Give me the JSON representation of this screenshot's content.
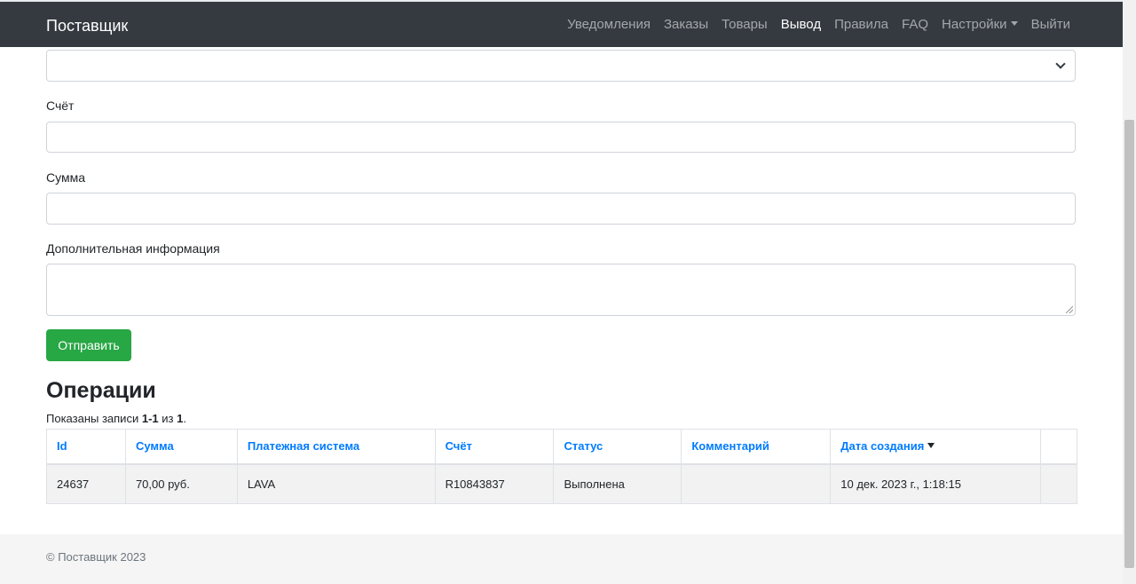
{
  "navbar": {
    "brand": "Поставщик",
    "links": [
      {
        "label": "Уведомления",
        "active": false
      },
      {
        "label": "Заказы",
        "active": false
      },
      {
        "label": "Товары",
        "active": false
      },
      {
        "label": "Вывод",
        "active": true
      },
      {
        "label": "Правила",
        "active": false
      },
      {
        "label": "FAQ",
        "active": false
      },
      {
        "label": "Настройки",
        "active": false,
        "dropdown": true
      },
      {
        "label": "Выйти",
        "active": false
      }
    ]
  },
  "form": {
    "payment_system_value": "",
    "account_label": "Счёт",
    "account_value": "",
    "sum_label": "Сумма",
    "sum_value": "",
    "info_label": "Дополнительная информация",
    "info_value": "",
    "submit_label": "Отправить"
  },
  "operations": {
    "title": "Операции",
    "summary_prefix": "Показаны записи",
    "summary_range": "1-1",
    "summary_of": "из",
    "summary_total": "1",
    "summary_end": ".",
    "columns": [
      "Id",
      "Сумма",
      "Платежная система",
      "Счёт",
      "Статус",
      "Комментарий",
      "Дата создания",
      ""
    ],
    "rows": [
      [
        "24637",
        "70,00 руб.",
        "LAVA",
        "R10843837",
        "Выполнена",
        "",
        "10 дек. 2023 г., 1:18:15",
        ""
      ]
    ]
  },
  "footer": {
    "text": "© Поставщик 2023"
  },
  "colors": {
    "navbar_bg": "#343a40",
    "link_blue": "#007bff",
    "success_green": "#28a745",
    "footer_bg": "#f5f5f5"
  }
}
